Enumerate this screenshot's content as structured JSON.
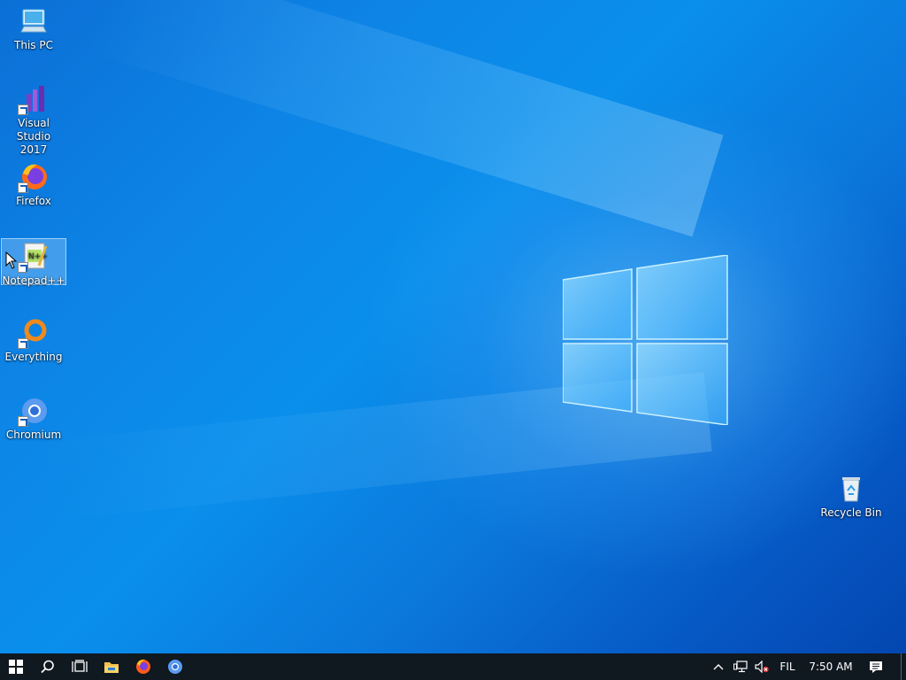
{
  "desktop": {
    "icons": [
      {
        "label": "This PC",
        "icon": "this-pc-icon"
      },
      {
        "label": "Visual Studio\n2017",
        "icon": "visual-studio-icon"
      },
      {
        "label": "Firefox",
        "icon": "firefox-icon"
      },
      {
        "label": "Notepad++",
        "icon": "notepad-plus-plus-icon"
      },
      {
        "label": "Everything",
        "icon": "everything-icon"
      },
      {
        "label": "Chromium",
        "icon": "chromium-icon"
      },
      {
        "label": "Recycle Bin",
        "icon": "recycle-bin-icon"
      }
    ],
    "selected": "Notepad++"
  },
  "taskbar": {
    "pinned": [
      "start-icon",
      "search-icon",
      "task-view-icon",
      "file-explorer-icon",
      "firefox-icon",
      "chromium-icon"
    ],
    "tray": {
      "language": "FIL",
      "time": "7:50 AM"
    }
  },
  "colors": {
    "taskbar_bg": "#101820",
    "desktop_accent": "#0a78d8"
  }
}
